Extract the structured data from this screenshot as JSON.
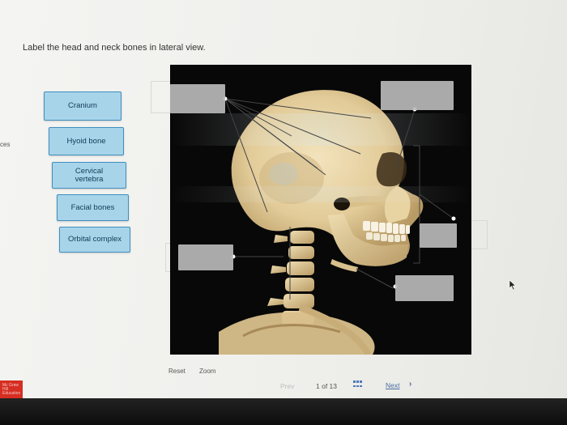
{
  "instruction": "Label the head and neck bones in lateral view.",
  "edge_text": "ces",
  "labels": [
    {
      "text": "Cranium"
    },
    {
      "text": "Hyoid bone"
    },
    {
      "text": "Cervical\nvertebra"
    },
    {
      "text": "Facial bones"
    },
    {
      "text": "Orbital complex"
    }
  ],
  "toolbar": {
    "reset": "Reset",
    "zoom": "Zoom"
  },
  "pager": {
    "prev": "Prev",
    "page": "1 of 13",
    "next": "Next"
  },
  "colors": {
    "chip_fill": "#a8d4ea",
    "chip_border": "#3e8fbe",
    "drop_zone": "#b8b8b8",
    "brand_red": "#d62e22"
  },
  "logo_text": "Mc Graw Hill Education"
}
